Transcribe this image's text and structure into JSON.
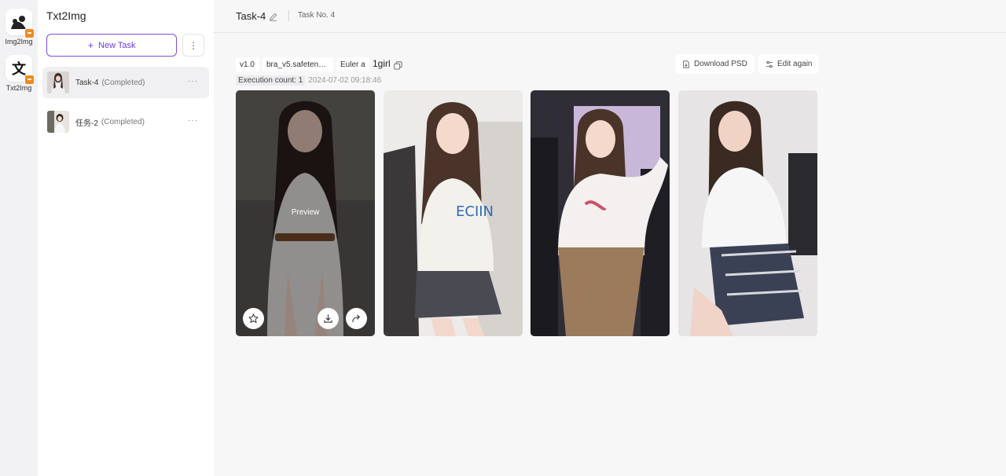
{
  "rail": {
    "items": [
      {
        "label": "Img2Img",
        "icon": "image-person-icon"
      },
      {
        "label": "Txt2Img",
        "icon": "text-translate-icon",
        "glyph": "文"
      }
    ]
  },
  "sidebar": {
    "title": "Txt2Img",
    "new_task_label": "New Task",
    "new_task_icon": "+",
    "tasks": [
      {
        "name": "Task-4",
        "status": "(Completed)",
        "active": true
      },
      {
        "name": "任务-2",
        "status": "(Completed)",
        "active": false
      }
    ],
    "more_glyph": "···"
  },
  "header": {
    "title": "Task-4",
    "task_no": "Task No. 4"
  },
  "params": {
    "version": "v1.0",
    "model": "bra_v5.safeten…",
    "sampler": "Euler a",
    "prompt": "1girl"
  },
  "execution": {
    "label": "Execution count: 1",
    "date": "2024-07-02 09:18:46"
  },
  "actions": {
    "download_psd": "Download PSD",
    "edit_again": "Edit again"
  },
  "images": {
    "preview_label": "Preview",
    "count": 4
  },
  "colors": {
    "accent": "#6b3fdc",
    "badge": "#f08a1c"
  }
}
